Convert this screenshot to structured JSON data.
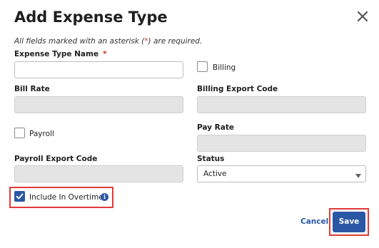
{
  "dialog": {
    "title": "Add Expense Type",
    "close_icon": "close-icon",
    "required_note": {
      "prefix": "All fields marked with an asterisk (",
      "asterisk": "*",
      "suffix": ") are required."
    }
  },
  "fields": {
    "expense_type_name": {
      "label": "Expense Type Name",
      "required_mark": "*",
      "value": ""
    },
    "billing": {
      "label": "Billing",
      "checked": false
    },
    "bill_rate": {
      "label": "Bill Rate",
      "value": ""
    },
    "billing_export_code": {
      "label": "Billing Export Code",
      "value": ""
    },
    "payroll": {
      "label": "Payroll",
      "checked": false
    },
    "pay_rate": {
      "label": "Pay Rate",
      "value": ""
    },
    "payroll_export_code": {
      "label": "Payroll Export Code",
      "value": ""
    },
    "status": {
      "label": "Status",
      "value": "Active"
    },
    "include_in_overtime": {
      "label": "Include In Overtime",
      "checked": true,
      "info_icon": "info-icon"
    }
  },
  "actions": {
    "cancel_label": "Cancel",
    "save_label": "Save"
  },
  "colors": {
    "primary": "#2a57a5",
    "highlight": "#e03a3a",
    "required": "#c0392b",
    "disabled_bg": "#e4e4e4"
  }
}
